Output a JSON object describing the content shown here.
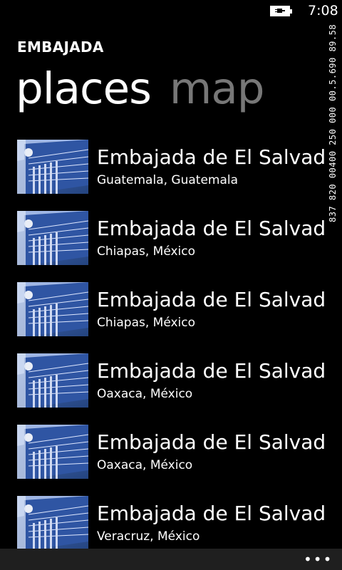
{
  "status": {
    "time": "7:08"
  },
  "debug_counter": "837 820 00400 250 000 00.5.690 89.58",
  "app": {
    "title": "EMBAJADA"
  },
  "pivot": {
    "items": [
      "places",
      "map"
    ],
    "active": 0
  },
  "places": [
    {
      "title": "Embajada de El Salvador",
      "location": "Guatemala, Guatemala"
    },
    {
      "title": "Embajada de El Salvador",
      "location": "Chiapas, México"
    },
    {
      "title": "Embajada de El Salvador",
      "location": "Chiapas, México"
    },
    {
      "title": "Embajada de El Salvador",
      "location": "Oaxaca, México"
    },
    {
      "title": "Embajada de El Salvador",
      "location": "Oaxaca, México"
    },
    {
      "title": "Embajada de El Salvador",
      "location": "Veracruz, México"
    }
  ],
  "app_bar": {
    "more_label": "•••"
  }
}
